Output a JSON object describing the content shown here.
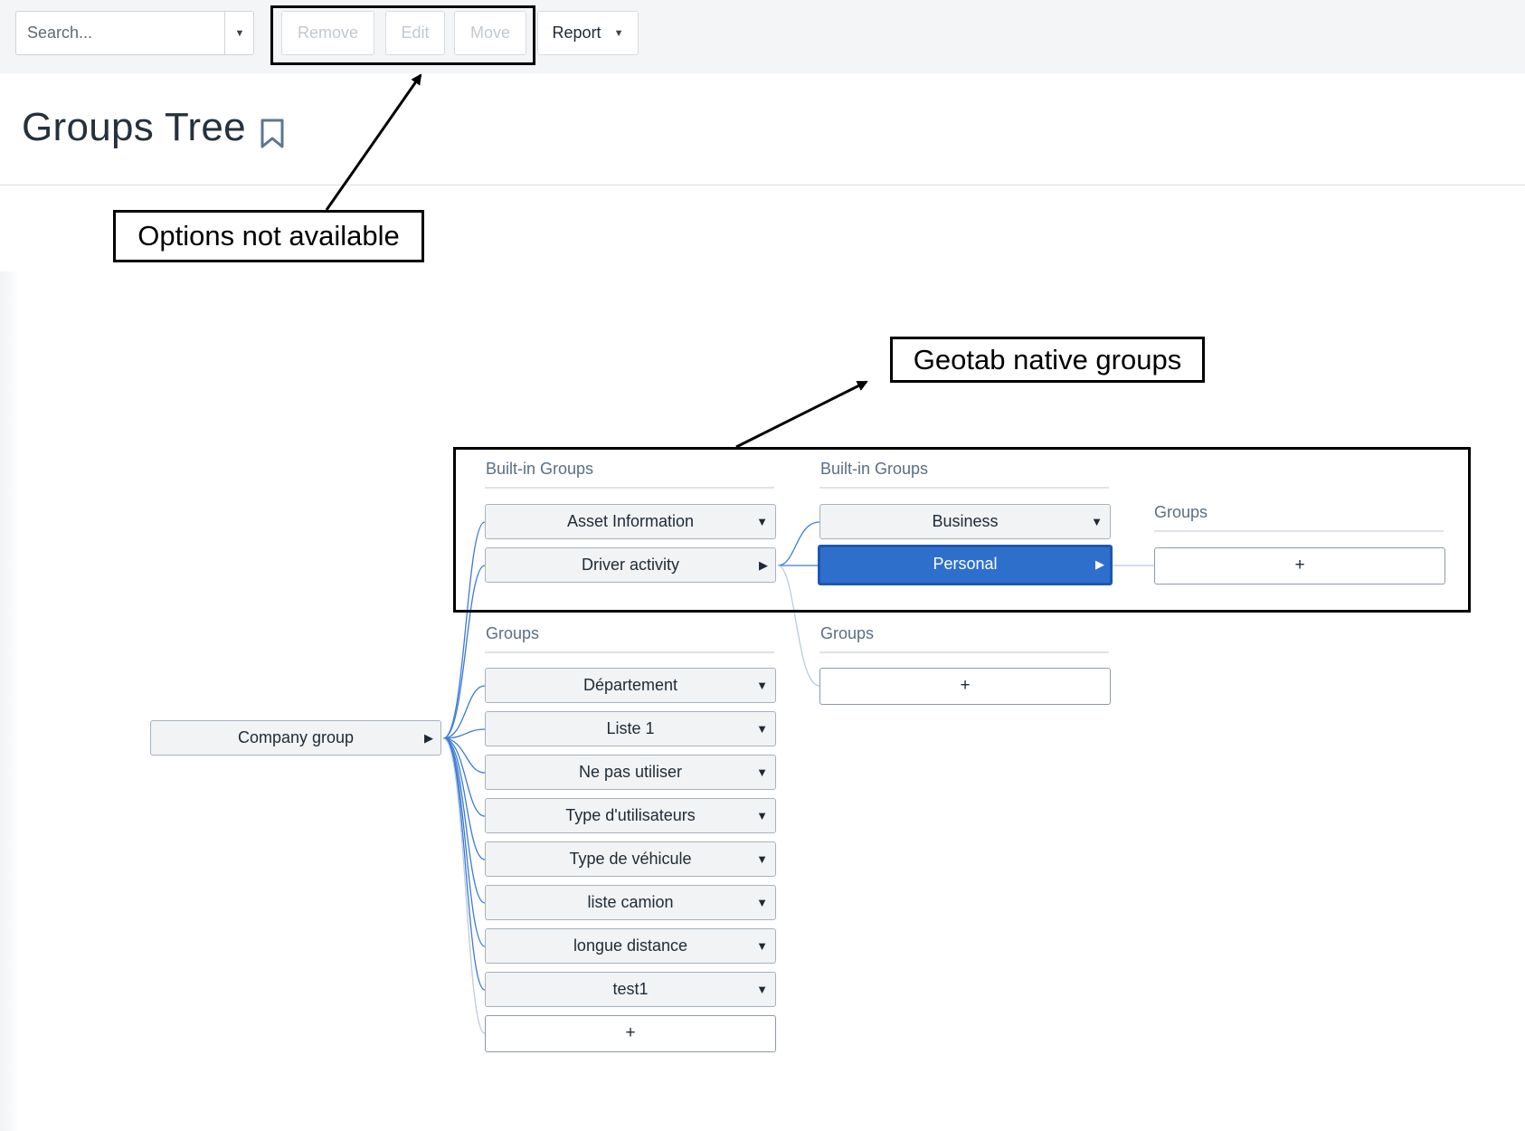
{
  "toolbar": {
    "search_placeholder": "Search...",
    "remove_label": "Remove",
    "edit_label": "Edit",
    "move_label": "Move",
    "report_label": "Report"
  },
  "page": {
    "title": "Groups Tree"
  },
  "annotations": {
    "options_callout": "Options not available",
    "native_callout": "Geotab native groups"
  },
  "tree": {
    "root": "Company group",
    "col1_builtin_title": "Built-in Groups",
    "col1_builtin_items": [
      "Asset Information",
      "Driver activity"
    ],
    "col1_groups_title": "Groups",
    "col1_groups_items": [
      "Département",
      "Liste 1",
      "Ne pas utiliser",
      "Type d'utilisateurs",
      "Type de véhicule",
      "liste camion",
      "longue distance",
      "test1"
    ],
    "col1_add": "+",
    "col2_builtin_title": "Built-in Groups",
    "col2_builtin_items": [
      "Business",
      "Personal"
    ],
    "col2_groups_title": "Groups",
    "col2_add": "+",
    "col3_groups_title": "Groups",
    "col3_add": "+"
  },
  "colors": {
    "selected_node": "#2f6fcc",
    "link_line": "#3a7bd5"
  }
}
